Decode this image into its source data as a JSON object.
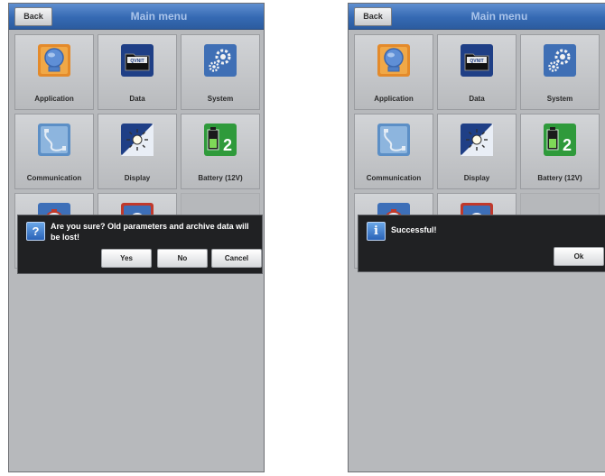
{
  "screens": [
    {
      "back_label": "Back",
      "title": "Main menu",
      "tiles": [
        {
          "label": "Application",
          "icon": "application-icon"
        },
        {
          "label": "Data",
          "icon": "data-folder-icon"
        },
        {
          "label": "System",
          "icon": "system-gear-icon"
        },
        {
          "label": "Communication",
          "icon": "communication-icon"
        },
        {
          "label": "Display",
          "icon": "display-brightness-icon"
        },
        {
          "label": "Battery (12V)",
          "icon": "battery-icon"
        }
      ],
      "dialog": {
        "icon": "question-icon",
        "icon_glyph": "?",
        "message": "Are you sure? Old parameters and archive data will be lost!",
        "buttons": [
          "Yes",
          "No",
          "Cancel"
        ]
      }
    },
    {
      "back_label": "Back",
      "title": "Main menu",
      "tiles": [
        {
          "label": "Application",
          "icon": "application-icon"
        },
        {
          "label": "Data",
          "icon": "data-folder-icon"
        },
        {
          "label": "System",
          "icon": "system-gear-icon"
        },
        {
          "label": "Communication",
          "icon": "communication-icon"
        },
        {
          "label": "Display",
          "icon": "display-brightness-icon"
        },
        {
          "label": "Battery (12V)",
          "icon": "battery-icon"
        }
      ],
      "dialog": {
        "icon": "info-icon",
        "icon_glyph": "i",
        "message": "Successful!",
        "buttons": [
          "Ok"
        ]
      }
    }
  ],
  "icon_text": {
    "data_folder": "QVNIT",
    "battery_number": "2"
  },
  "colors": {
    "topbar": "#3569b3",
    "dialog_bg": "#202123",
    "screen_bg": "#b7b9bc"
  }
}
